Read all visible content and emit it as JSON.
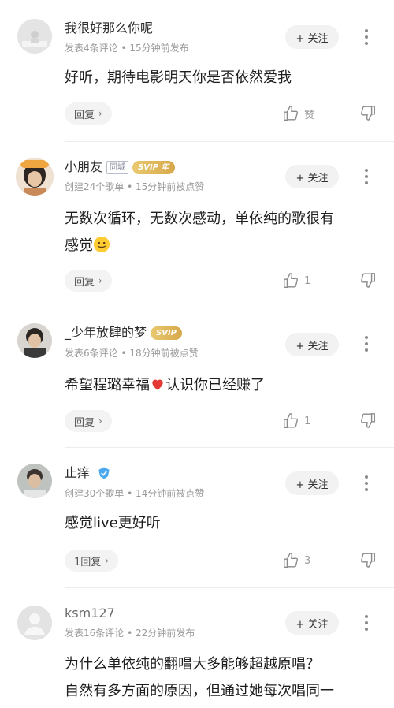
{
  "follow_label": "+ 关注",
  "comments": [
    {
      "username": "我很好那么你呢",
      "meta": "发表4条评论 • 15分钟前发布",
      "text": "好听，期待电影明天你是否依然爱我",
      "reply": "回复",
      "like_label": "赞",
      "like_count": ""
    },
    {
      "username": "小朋友",
      "tag": "同城",
      "vip": "SVIP 年",
      "meta": "创建24个歌单 • 15分钟前被点赞",
      "text_line1": "无数次循环，无数次感动，单依纯的歌很有",
      "text_line2": "感觉",
      "reply": "回复",
      "like_count": "1",
      "avatar_badge": "绿色心情"
    },
    {
      "username": "_少年放肆的梦",
      "vip": "SVIP",
      "meta": "发表6条评论 • 18分钟前被点赞",
      "text_part1": "希望程璐幸福",
      "text_part2": "认识你已经赚了",
      "reply": "回复",
      "like_count": "1"
    },
    {
      "username": "止痒",
      "meta": "创建30个歌单 • 14分钟前被点赞",
      "text": "感觉live更好听",
      "reply": "1回复",
      "like_count": "3"
    },
    {
      "username": "ksm127",
      "meta": "发表16条评论 • 22分钟前发布",
      "text_line1": "为什么单依纯的翻唱大多能够超越原唱？",
      "text_line2": "自然有多方面的原因，但通过她每次唱同一"
    }
  ],
  "colors": {
    "vip_gold": "#d9ab4c",
    "follow_bg": "#f2f2f2",
    "meta_gray": "#9a9a9a",
    "heart_red": "#e53935"
  }
}
